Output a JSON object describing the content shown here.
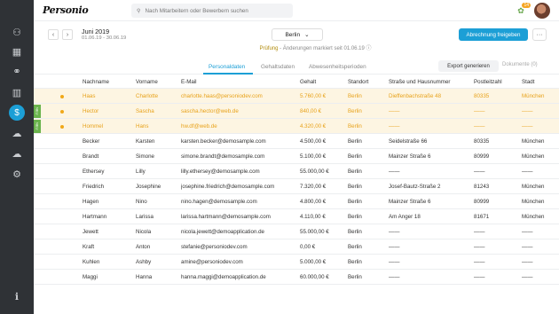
{
  "app": {
    "logo": "Personio"
  },
  "search": {
    "placeholder": "Nach Mitarbeitern oder Bewerbern suchen"
  },
  "notifications": {
    "count": "14"
  },
  "header": {
    "period_title": "Juni 2019",
    "period_range": "01.06.19 - 30.06.19",
    "location": "Berlin",
    "status_label": "Prüfung",
    "status_text": " - Änderungen markiert seit 01.06.19",
    "approve_label": "Abrechnung freigeben",
    "more_label": "···",
    "prev_icon": "‹",
    "next_icon": "›"
  },
  "tabs": [
    {
      "label": "Personaldaten",
      "active": true
    },
    {
      "label": "Gehaltsdaten",
      "active": false
    },
    {
      "label": "Abwesenheitsperioden",
      "active": false
    }
  ],
  "actions": {
    "export_label": "Export generieren",
    "documents_label": "Dokumente (0)"
  },
  "table": {
    "columns": [
      "Nachname",
      "Vorname",
      "E-Mail",
      "Gehalt",
      "Standort",
      "Straße und Hausnummer",
      "Postleitzahl",
      "Stadt"
    ],
    "rows": [
      {
        "highlight": true,
        "tag": "",
        "cells": [
          "Haas",
          "Charlotte",
          "charlotte.haas@personiodev.com",
          "5.760,00 €",
          "Berlin",
          "Dieffenbachstraße 48",
          "80335",
          "München"
        ]
      },
      {
        "highlight": true,
        "tag": "NEU",
        "cells": [
          "Hector",
          "Sascha",
          "sascha.hector@web.de",
          "840,00 €",
          "Berlin",
          "——",
          "——",
          "——"
        ]
      },
      {
        "highlight": true,
        "tag": "NEU",
        "cells": [
          "Hommel",
          "Hans",
          "hw.df@web.de",
          "4.320,00 €",
          "Berlin",
          "——",
          "——",
          "——"
        ]
      },
      {
        "highlight": false,
        "tag": "",
        "cells": [
          "Becker",
          "Karsten",
          "karsten.becker@demosample.com",
          "4.500,00 €",
          "Berlin",
          "Seidelstraße 66",
          "80335",
          "München"
        ]
      },
      {
        "highlight": false,
        "tag": "",
        "cells": [
          "Brandt",
          "Simone",
          "simone.brandt@demosample.com",
          "5.100,00 €",
          "Berlin",
          "Mainzer Straße 6",
          "80999",
          "München"
        ]
      },
      {
        "highlight": false,
        "tag": "",
        "cells": [
          "Ethersey",
          "Lilly",
          "lilly.ethersey@demosample.com",
          "55.000,00 €",
          "Berlin",
          "——",
          "——",
          "——"
        ]
      },
      {
        "highlight": false,
        "tag": "",
        "cells": [
          "Friedrich",
          "Josephine",
          "josephine.friedrich@demosample.com",
          "7.320,00 €",
          "Berlin",
          "Josef-Bautz-Straße 2",
          "81243",
          "München"
        ]
      },
      {
        "highlight": false,
        "tag": "",
        "cells": [
          "Hagen",
          "Nino",
          "nino.hagen@demosample.com",
          "4.800,00 €",
          "Berlin",
          "Mainzer Straße 6",
          "80999",
          "München"
        ]
      },
      {
        "highlight": false,
        "tag": "",
        "cells": [
          "Hartmann",
          "Larissa",
          "larissa.hartmann@demosample.com",
          "4.110,00 €",
          "Berlin",
          "Am Anger 18",
          "81671",
          "München"
        ]
      },
      {
        "highlight": false,
        "tag": "",
        "cells": [
          "Jewett",
          "Nicola",
          "nicola.jewett@demoapplication.de",
          "55.000,00 €",
          "Berlin",
          "——",
          "——",
          "——"
        ]
      },
      {
        "highlight": false,
        "tag": "",
        "cells": [
          "Kraft",
          "Anton",
          "stefanie@personiodev.com",
          "0,00 €",
          "Berlin",
          "——",
          "——",
          "——"
        ]
      },
      {
        "highlight": false,
        "tag": "",
        "cells": [
          "Kuhlen",
          "Ashby",
          "amine@personiodev.com",
          "5.000,00 €",
          "Berlin",
          "——",
          "——",
          "——"
        ]
      },
      {
        "highlight": false,
        "tag": "",
        "cells": [
          "Maggi",
          "Hanna",
          "hanna.maggi@demoapplication.de",
          "60.000,00 €",
          "Berlin",
          "——",
          "——",
          "——"
        ]
      }
    ]
  },
  "colors": {
    "accent": "#1c9fd6",
    "highlight_row": "#fdf5e2",
    "highlight_text": "#e8a21a",
    "sidebar": "#2f3236",
    "new_tag": "#69b34c"
  },
  "sidebar_icons": [
    "people-icon",
    "calendar-icon",
    "handshake-icon",
    "chart-icon",
    "payroll-icon",
    "cloud-upload-icon",
    "cloud-download-icon",
    "settings-icon",
    "info-icon"
  ]
}
